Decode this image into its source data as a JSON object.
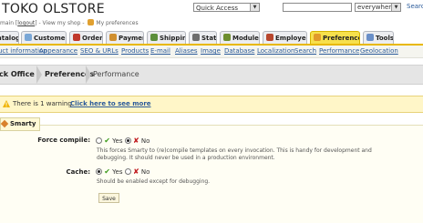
{
  "header": {
    "shop_name": "TOKO OLSTORE",
    "user_prefix": "main [",
    "logout": "logout",
    "user_mid": "] - View my shop - ",
    "my_preferences": "My preferences",
    "quick_access": "Quick Access",
    "search_value": "",
    "search_scope": "everywhere",
    "search_label": "Searc"
  },
  "tabs": [
    {
      "label": "atalog",
      "color": "#6a8fc8"
    },
    {
      "label": "Customers",
      "color": "#7aa7d6"
    },
    {
      "label": "Orders",
      "color": "#c0382b"
    },
    {
      "label": "Payment",
      "color": "#d08f2f"
    },
    {
      "label": "Shipping",
      "color": "#5b8e3a"
    },
    {
      "label": "Stats",
      "color": "#6d6d6d"
    },
    {
      "label": "Modules",
      "color": "#6d8e2e"
    },
    {
      "label": "Employees",
      "color": "#b8472e"
    },
    {
      "label": "Preferences",
      "color": "#e19a2a"
    },
    {
      "label": "Tools",
      "color": "#6a8fc8"
    }
  ],
  "subnav": [
    "uct information",
    "Appearance",
    "SEO & URLs",
    "Products",
    "E-mail",
    "Aliases",
    "Image",
    "Database",
    "Localization",
    "Search",
    "Performance",
    "Geolocation"
  ],
  "breadcrumb": [
    "ck Office",
    "Preferences",
    "Performance"
  ],
  "warning": {
    "text": "There is 1 warning",
    "link": "Click here to see more"
  },
  "section": {
    "legend": "Smarty",
    "force_compile": {
      "label": "Force compile:",
      "yes": "Yes",
      "no": "No",
      "hint": "This forces Smarty to (re)compile templates on every invocation. This is handy for development and debugging. It should never be used in a production environment."
    },
    "cache": {
      "label": "Cache:",
      "yes": "Yes",
      "no": "No",
      "hint": "Should be enabled except for debugging."
    },
    "save": "Save"
  }
}
